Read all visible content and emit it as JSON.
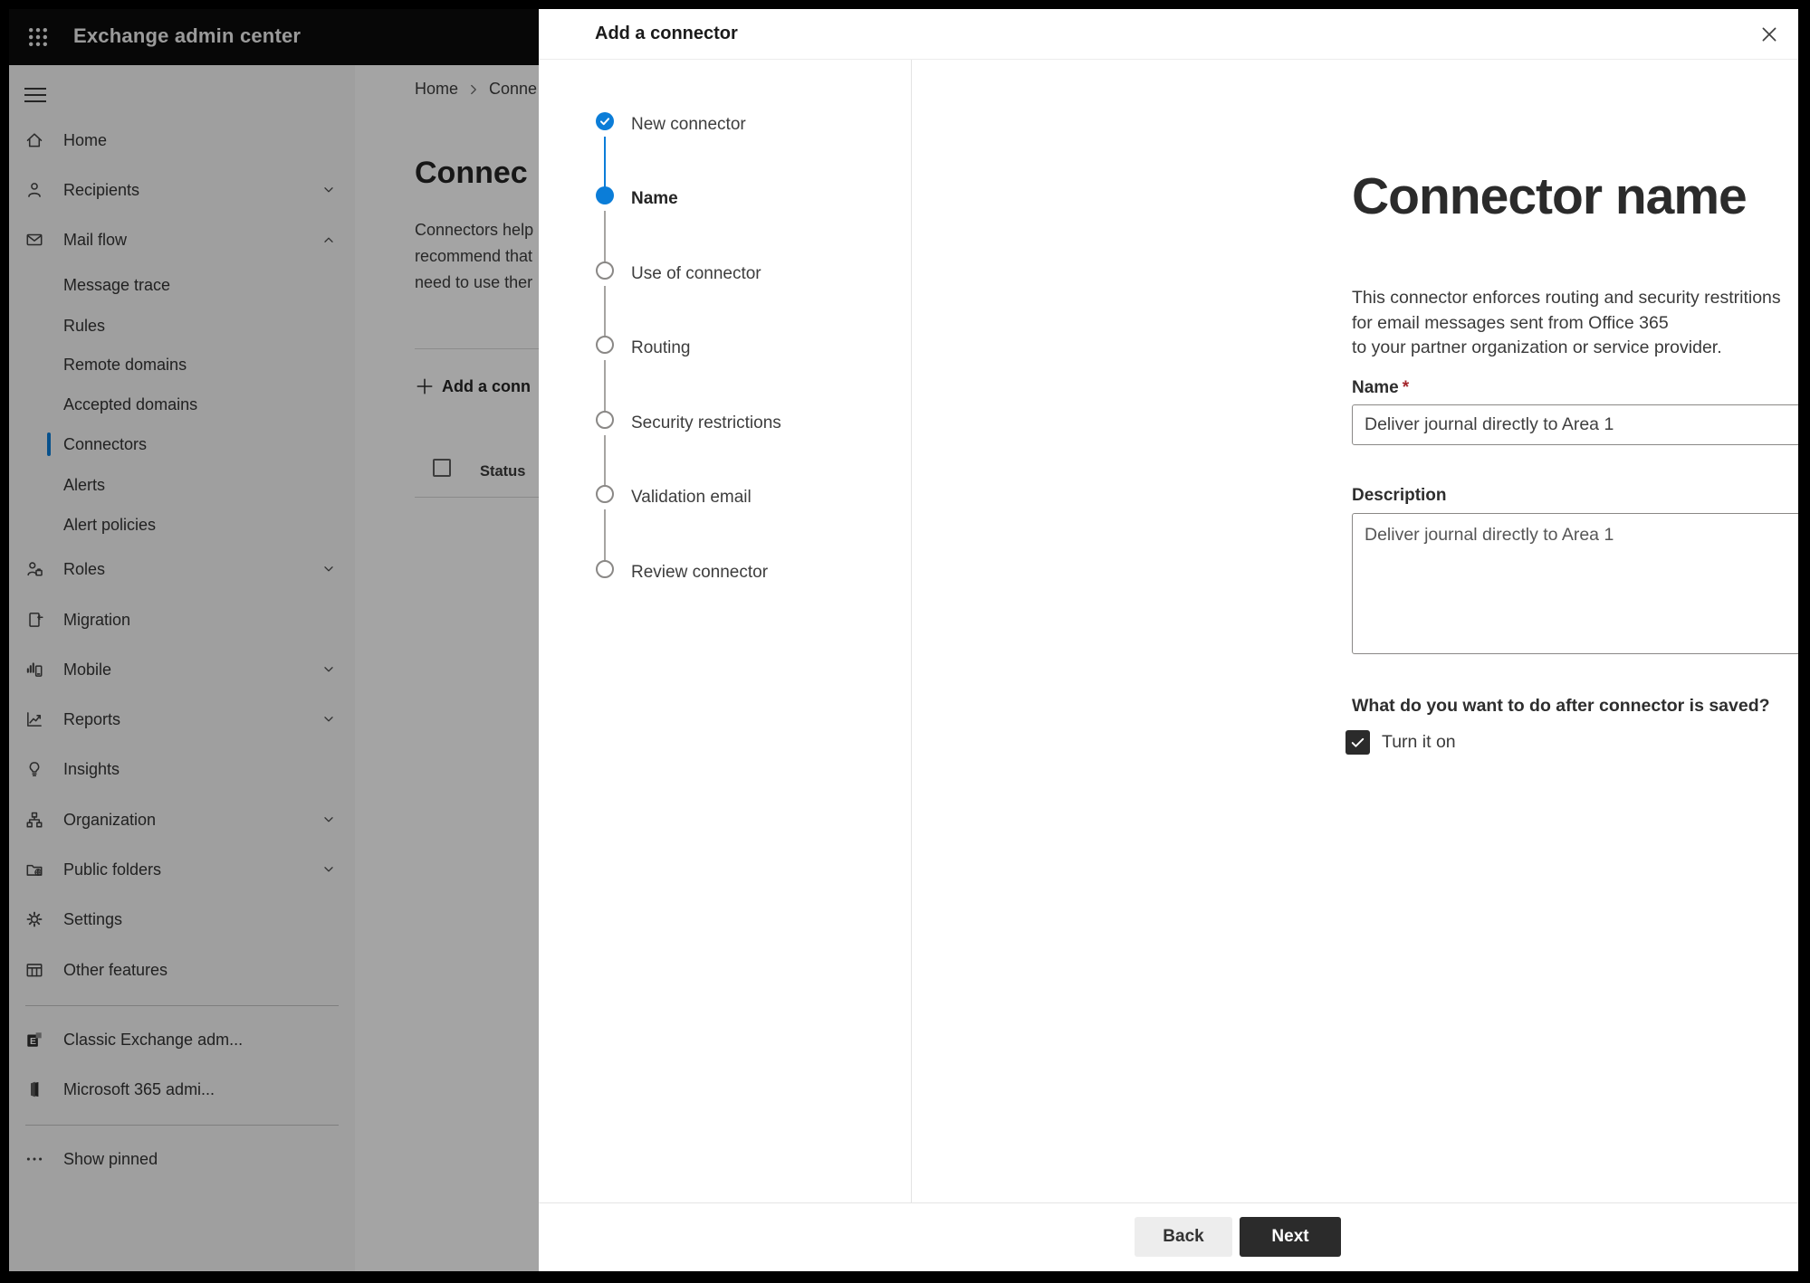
{
  "colors": {
    "accent_blue": "#0b7dd8",
    "required_red": "#a4262c",
    "primary_button_dark": "#2b2b2b"
  },
  "app": {
    "title": "Exchange admin center",
    "launcher_icon": "waffle-icon",
    "menu_icon": "hamburger-icon"
  },
  "sidebar": {
    "items": [
      {
        "label": "Home",
        "icon": "home-icon",
        "type": "main"
      },
      {
        "label": "Recipients",
        "icon": "person-icon",
        "chevron": "down",
        "type": "main"
      },
      {
        "label": "Mail flow",
        "icon": "mail-icon",
        "chevron": "up",
        "type": "main"
      },
      {
        "label": "Message trace",
        "type": "sub"
      },
      {
        "label": "Rules",
        "type": "sub"
      },
      {
        "label": "Remote domains",
        "type": "sub"
      },
      {
        "label": "Accepted domains",
        "type": "sub"
      },
      {
        "label": "Connectors",
        "type": "sub",
        "selected": true
      },
      {
        "label": "Alerts",
        "type": "sub"
      },
      {
        "label": "Alert policies",
        "type": "sub"
      },
      {
        "label": "Roles",
        "icon": "roles-icon",
        "chevron": "down",
        "type": "main"
      },
      {
        "label": "Migration",
        "icon": "migration-icon",
        "type": "main"
      },
      {
        "label": "Mobile",
        "icon": "mobile-icon",
        "chevron": "down",
        "type": "main"
      },
      {
        "label": "Reports",
        "icon": "reports-icon",
        "chevron": "down",
        "type": "main"
      },
      {
        "label": "Insights",
        "icon": "lightbulb-icon",
        "type": "main"
      },
      {
        "label": "Organization",
        "icon": "org-tree-icon",
        "chevron": "down",
        "type": "main"
      },
      {
        "label": "Public folders",
        "icon": "folder-globe-icon",
        "chevron": "down",
        "type": "main"
      },
      {
        "label": "Settings",
        "icon": "gear-icon",
        "type": "main"
      },
      {
        "label": "Other features",
        "icon": "table-icon",
        "type": "main"
      }
    ],
    "footer_items": [
      {
        "label": "Classic Exchange adm...",
        "icon": "exchange-logo-icon"
      },
      {
        "label": "Microsoft 365 admi...",
        "icon": "microsoft-365-icon"
      }
    ],
    "show_pinned_label": "Show pinned",
    "show_pinned_icon": "ellipsis-icon"
  },
  "page": {
    "breadcrumb": {
      "home": "Home",
      "current": "Conne"
    },
    "title": "Connec",
    "paragraph_lines": [
      "Connectors help",
      "recommend that",
      "need to use ther"
    ],
    "add_button_label": "Add a conn",
    "table": {
      "status_header": "Status"
    }
  },
  "dialog": {
    "title": "Add a connector",
    "close_icon": "close-icon",
    "steps": [
      {
        "label": "New connector",
        "state": "completed"
      },
      {
        "label": "Name",
        "state": "current"
      },
      {
        "label": "Use of connector",
        "state": "upcoming"
      },
      {
        "label": "Routing",
        "state": "upcoming"
      },
      {
        "label": "Security restrictions",
        "state": "upcoming"
      },
      {
        "label": "Validation email",
        "state": "upcoming"
      },
      {
        "label": "Review connector",
        "state": "upcoming"
      }
    ],
    "content": {
      "title": "Connector name",
      "description_lines": [
        "This connector enforces routing and security restritions for email messages sent from Office 365",
        "to your partner organization or service provider."
      ],
      "name_label": "Name",
      "required_marker": "*",
      "name_value": "Deliver journal directly to Area 1",
      "description_label": "Description",
      "description_value": "Deliver journal directly to Area 1",
      "question": "What do you want to do after connector is saved?",
      "checkbox_label": "Turn it on",
      "checkbox_checked": true
    },
    "footer": {
      "back_label": "Back",
      "next_label": "Next"
    }
  }
}
